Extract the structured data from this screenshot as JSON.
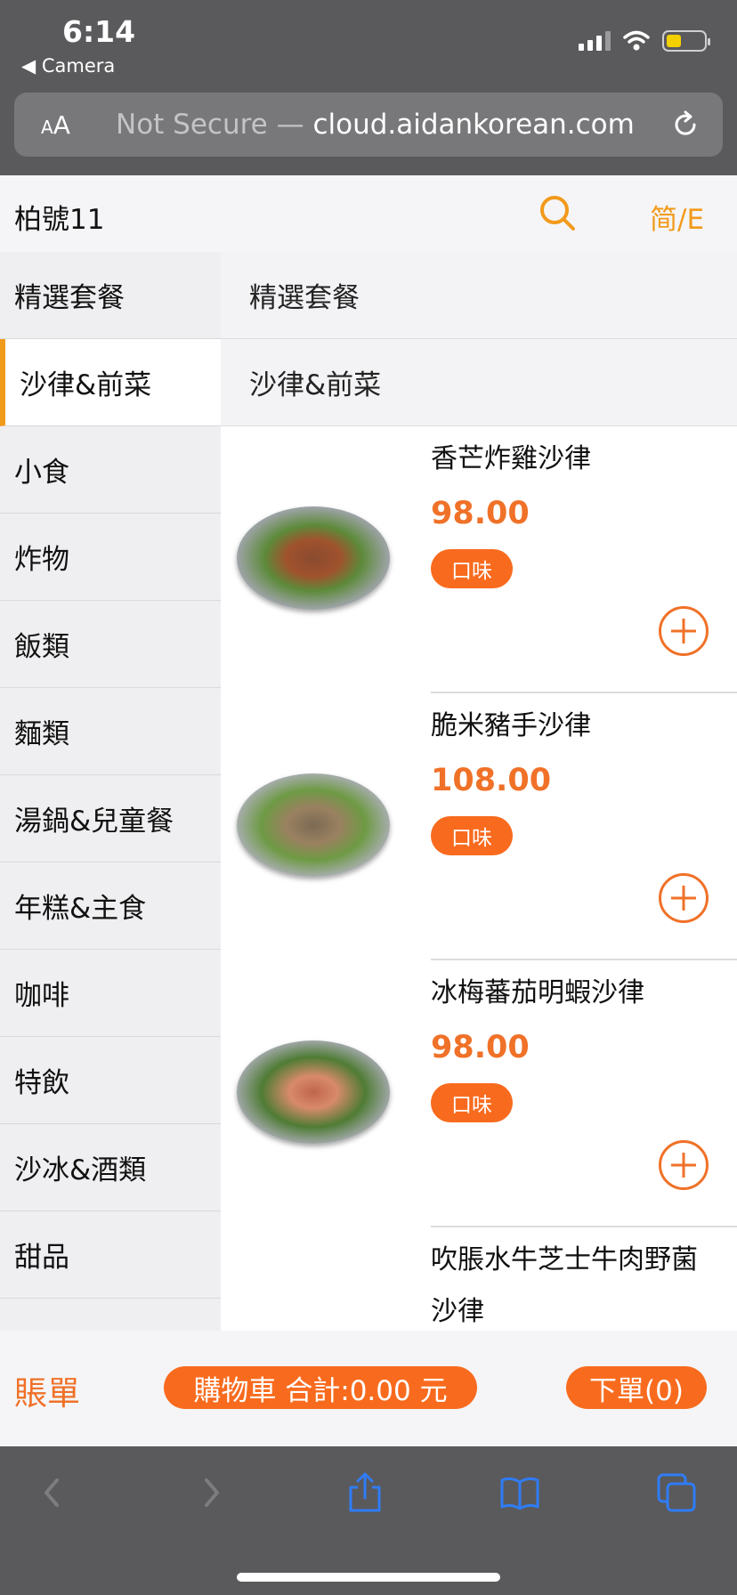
{
  "status": {
    "time": "6:14",
    "back_app": "◀ Camera"
  },
  "browser": {
    "aa_label_small": "A",
    "aa_label_large": "A",
    "url_prefix": "Not Secure — ",
    "url_domain": "cloud.aidankorean.com"
  },
  "header": {
    "store_name": "柏號11",
    "lang_toggle": "简/E"
  },
  "sidebar": {
    "items": [
      {
        "label": "精選套餐"
      },
      {
        "label": "沙律&前菜"
      },
      {
        "label": "小食"
      },
      {
        "label": "炸物"
      },
      {
        "label": "飯類"
      },
      {
        "label": "麵類"
      },
      {
        "label": "湯鍋&兒童餐"
      },
      {
        "label": "年糕&主食"
      },
      {
        "label": "咖啡"
      },
      {
        "label": "特飲"
      },
      {
        "label": "沙冰&酒類"
      },
      {
        "label": "甜品"
      }
    ],
    "active_index": 1
  },
  "content": {
    "sections": [
      {
        "title": "精選套餐"
      },
      {
        "title": "沙律&前菜"
      }
    ],
    "dishes": [
      {
        "name": "香芒炸雞沙律",
        "price": "98.00",
        "flavor_label": "口味"
      },
      {
        "name": "脆米豬手沙律",
        "price": "108.00",
        "flavor_label": "口味"
      },
      {
        "name": "冰梅蕃茄明蝦沙律",
        "price": "98.00",
        "flavor_label": "口味"
      },
      {
        "name": "吹脹水牛芝士牛肉野菌沙律"
      }
    ]
  },
  "footer": {
    "bill_label": "賬單",
    "cart_label": "購物車 合計:0.00 元",
    "order_label": "下單(0)"
  },
  "colors": {
    "accent_orange": "#f86b1e",
    "price_orange": "#f07128",
    "active_marker": "#f29a1b",
    "safari_blue": "#2f7cf6"
  }
}
